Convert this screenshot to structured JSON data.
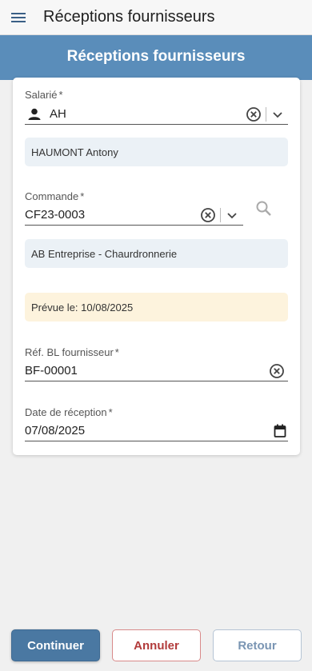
{
  "appbar": {
    "title": "Réceptions fournisseurs"
  },
  "banner": {
    "title": "Réceptions fournisseurs"
  },
  "form": {
    "salarie": {
      "label": "Salarié",
      "required": "*",
      "value": "AH",
      "info": "HAUMONT Antony"
    },
    "commande": {
      "label": "Commande",
      "required": "*",
      "value": "CF23-0003",
      "info": "AB Entreprise - Chaurdronnerie",
      "notice": "Prévue le: 10/08/2025"
    },
    "ref_bl": {
      "label": "Réf. BL fournisseur",
      "required": "*",
      "value": "BF-00001"
    },
    "date": {
      "label": "Date de réception",
      "required": "*",
      "value": "07/08/2025"
    }
  },
  "buttons": {
    "continue": "Continuer",
    "cancel": "Annuler",
    "back": "Retour"
  },
  "colors": {
    "banner": "#5a8dba",
    "primary": "#4a78a2",
    "cancel": "#b23b3b",
    "back": "#7a95b3",
    "notice_bg": "#fdf3dd",
    "info_bg": "#ebf1f6"
  },
  "icons": {
    "menu": "hamburger-icon",
    "person": "person-icon",
    "clear": "clear-circle-icon",
    "dropdown": "chevron-down-icon",
    "search": "search-icon",
    "calendar": "calendar-icon"
  }
}
